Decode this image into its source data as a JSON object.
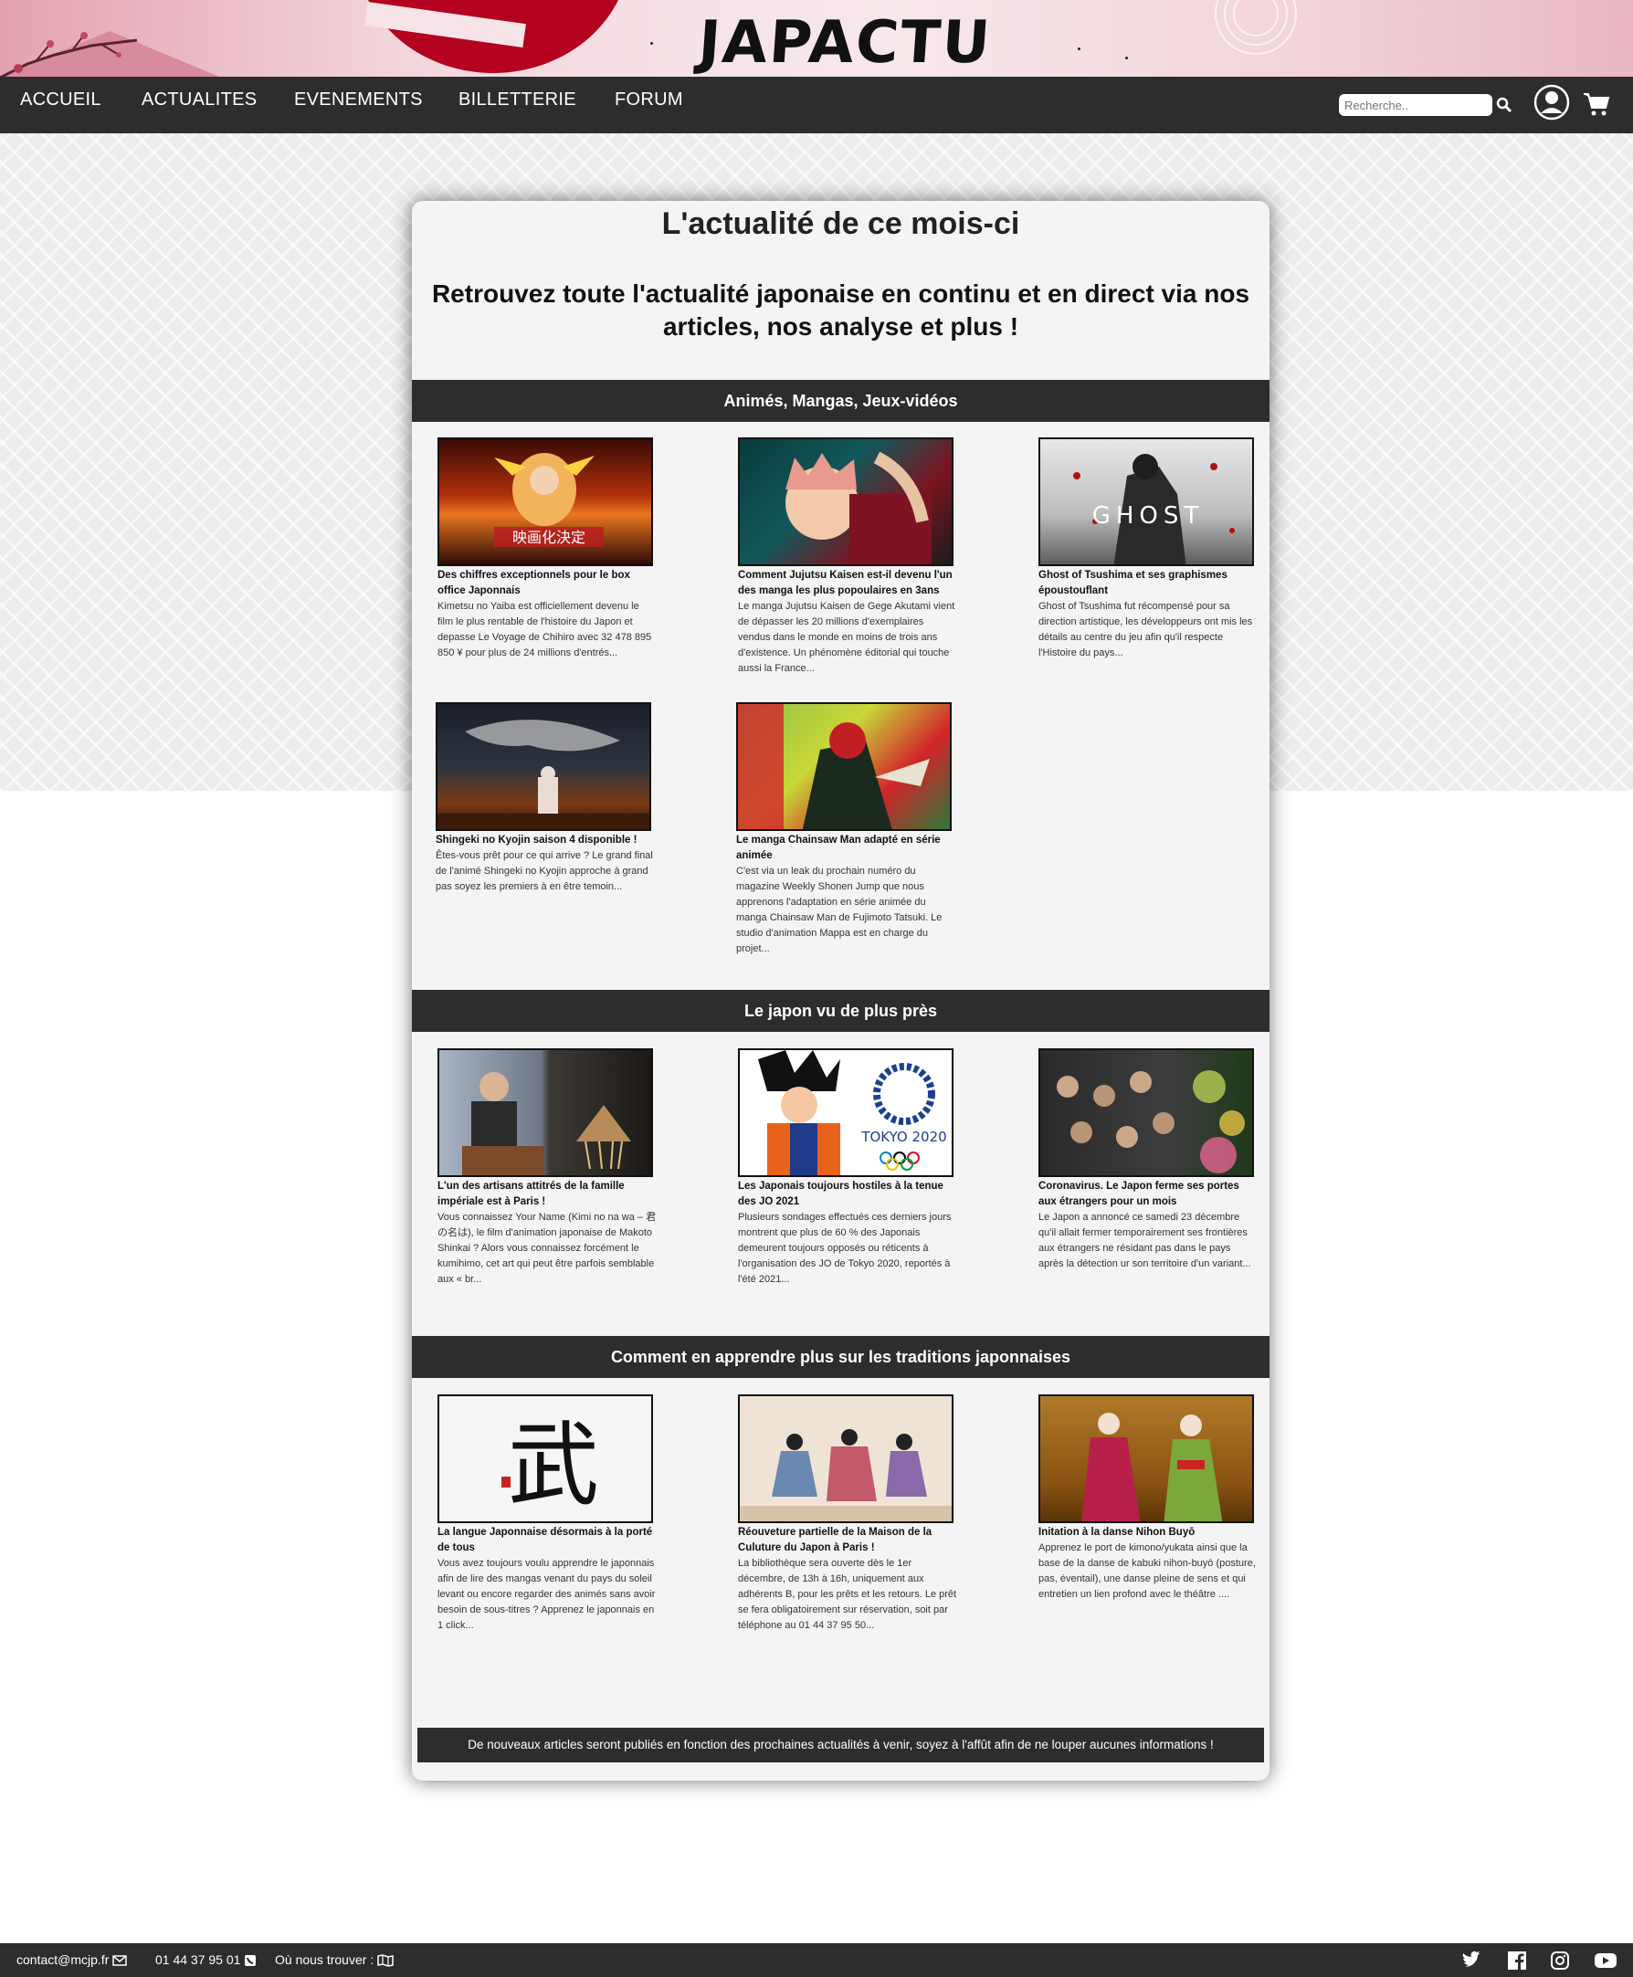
{
  "logo": "JAPACTU",
  "nav": {
    "items": [
      "ACCUEIL",
      "ACTUALITES",
      "EVENEMENTS",
      "BILLETTERIE",
      "FORUM"
    ],
    "search_placeholder": "Recherche.."
  },
  "main": {
    "title": "L'actualité de ce mois-ci",
    "intro": "Retrouvez toute l'actualité japonaise en continu et en direct via nos articles, nos analyse et plus !",
    "sections": [
      {
        "title": "Animés, Mangas, Jeux-vidéos",
        "articles": [
          {
            "title": "Des chiffres exceptionnels pour le box office Japonnais",
            "desc": "Kimetsu no Yaiba est officiellement devenu le film le plus rentable de l'histoire du Japon et depasse Le Voyage de Chihiro avec 32 478 895 850 ¥ pour plus de 24 millions d'entrés..."
          },
          {
            "title": "Comment Jujutsu Kaisen est-il devenu l'un des manga les plus popoulaires en 3ans",
            "desc": "Le manga Jujutsu Kaisen de Gege Akutami vient de dépasser les 20 millions d'exemplaires vendus dans le monde en moins de trois ans d'existence. Un phénomène éditorial qui touche aussi la France..."
          },
          {
            "title": "Ghost of Tsushima et ses graphismes époustouflant",
            "desc": "Ghost of Tsushima fut récompensé pour sa direction artistique, les développeurs ont mis les détails au centre du jeu afin qu'il respecte l'Histoire du pays..."
          },
          {
            "title": "Shingeki no Kyojin saison 4 disponible !",
            "desc": "Êtes-vous prêt pour ce qui arrive ? Le grand final de l'animé Shingeki no Kyojin approche à grand pas soyez les premiers à en être temoin..."
          },
          {
            "title": "Le manga Chainsaw Man adapté en série animée",
            "desc": "C'est via un leak du prochain numéro du magazine Weekly Shonen Jump que nous apprenons l'adaptation en série animée du manga Chainsaw Man de Fujimoto Tatsuki. Le studio d'animation Mappa est en charge du projet..."
          }
        ]
      },
      {
        "title": "Le japon vu de plus près",
        "articles": [
          {
            "title": "L'un des artisans attitrés de la famille impériale est à Paris !",
            "desc": "Vous connaissez Your Name (Kimi no na wa – 君の名は), le film d'animation japonaise de Makoto Shinkai ? Alors vous connaissez forcément le kumihimo, cet art qui peut être parfois semblable aux « br..."
          },
          {
            "title": "Les Japonais toujours hostiles à la tenue des JO 2021",
            "desc": "Plusieurs sondages effectués ces derniers jours montrent que plus de 60 % des Japonais demeurent toujours opposés ou réticents à l'organisation des JO de Tokyo 2020, reportés à l'été 2021..."
          },
          {
            "title": "Coronavirus. Le Japon ferme ses portes aux étrangers pour un mois",
            "desc": "Le Japon a annoncé ce samedi 23 décembre qu'il allait fermer temporairement ses frontières aux étrangers ne résidant pas dans le pays après la détection ur son territoire d'un variant..."
          }
        ]
      },
      {
        "title": "Comment en apprendre plus sur les traditions japonnaises",
        "articles": [
          {
            "title": "La langue Japonnaise désormais à la porté de tous",
            "desc": "Vous avez toujours voulu apprendre le japonnais afin de lire des mangas venant du pays du soleil levant ou encore regarder des animés sans avoir besoin de sous-titres ? Apprenez le japonnais en 1 click..."
          },
          {
            "title": "Réouveture partielle de la Maison de la Culuture du Japon à Paris !",
            "desc": "La bibliothèque sera ouverte dès le 1er décembre, de 13h à 16h, uniquement aux adhérents B, pour les prêts et les retours. Le prêt se fera obligatoirement sur réservation, soit par téléphone au 01 44 37 95 50..."
          },
          {
            "title": "Initation à la danse Nihon Buyō",
            "desc": "Apprenez le port de kimono/yukata ainsi que la base de la danse de kabuki nihon-buyō (posture, pas, éventail), une danse pleine de sens et qui entretien un lien profond avec le théâtre ...."
          }
        ]
      }
    ],
    "footnote": "De nouveaux articles seront publiés en fonction des prochaines actualités à venir, soyez à l'affût afin de ne louper aucunes informations !"
  },
  "footer": {
    "email": "contact@mcjp.fr",
    "phone": "01 44 37 95 01",
    "location_label": "Où nous trouver :"
  },
  "thumb_texts": {
    "kimetsu": "映画化決定",
    "ghost": "GHOST",
    "tokyo": "TOKYO 2020",
    "bu": "武"
  },
  "colors": {
    "nav_bg": "#2b2d2f",
    "sun_red": "#b4011f",
    "card_bg": "#f4f4f4"
  }
}
